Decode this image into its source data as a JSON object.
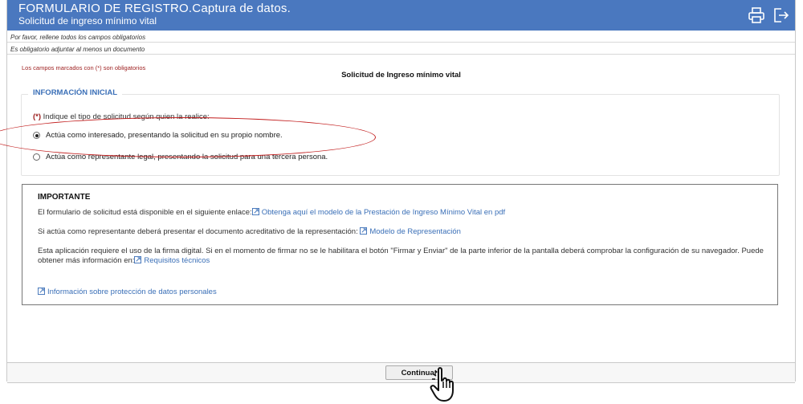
{
  "header": {
    "title": "FORMULARIO DE REGISTRO.Captura de datos.",
    "subtitle": "Solicitud de ingreso mínimo vital",
    "print_icon": "printer-icon",
    "exit_icon": "logout-icon",
    "background_color": "#4a78bf"
  },
  "notices": [
    "Por favor, rellene todos los campos obligatorios",
    "Es obligatorio adjuntar al menos un documento"
  ],
  "required_note": "Los campos marcados con (*) son obligatorios",
  "form_title": "Solicitud de Ingreso mínimo vital",
  "section": {
    "legend": "INFORMACIÓN INICIAL",
    "question_mark": "(*)",
    "question": " Indique el tipo de solicitud según quien la realice:",
    "options": [
      {
        "label": "Actúa como interesado, presentando la solicitud en su propio nombre.",
        "selected": true
      },
      {
        "label": "Actúa como representante legal, presentando la solicitud para una tercera persona.",
        "selected": false
      }
    ]
  },
  "important": {
    "title": "IMPORTANTE",
    "line1_text": "El formulario de solicitud está disponible en el siguiente enlace:",
    "line1_link": "Obtenga aquí el modelo de la Prestación de Ingreso Mínimo Vital en pdf",
    "line2_text": "Si actúa como representante deberá presentar el documento acreditativo de la representación:",
    "line2_link": "Modelo de Representación",
    "line3_text": "Esta aplicación requiere el uso de la firma digital. Si en el momento de firmar no se le habilitara el botón \"Firmar y Enviar\" de la parte inferior de la pantalla deberá comprobar la configuración de su navegador. Puede",
    "line4_text": "obtener más información en:",
    "line4_link": "Requisitos técnicos",
    "privacy_link": "Información sobre protección de datos personales",
    "link_icon": "external-link-icon"
  },
  "footer": {
    "continue_label": "Continuar"
  },
  "annotations": {
    "highlight_color": "#c21d1d",
    "cursor_icon": "hand-pointer-icon"
  }
}
